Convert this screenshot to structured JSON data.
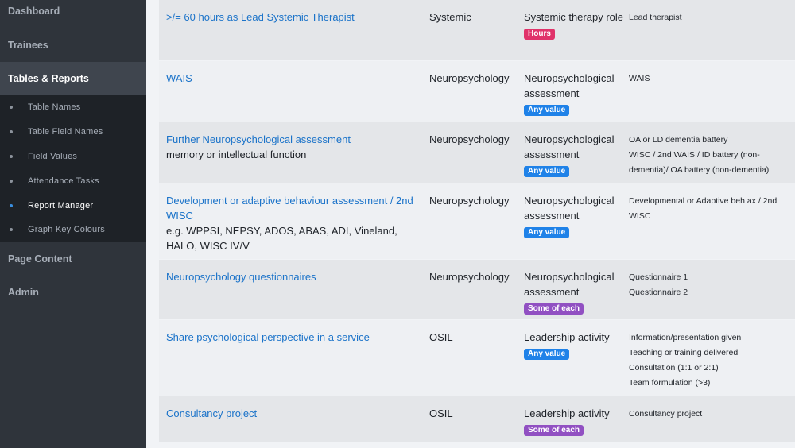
{
  "sidebar": {
    "top_items": [
      {
        "label": "Dashboard"
      },
      {
        "label": "Trainees"
      },
      {
        "label": "Tables & Reports"
      }
    ],
    "sub_items": [
      {
        "label": "Table Names"
      },
      {
        "label": "Table Field Names"
      },
      {
        "label": "Field Values"
      },
      {
        "label": "Attendance Tasks"
      },
      {
        "label": "Report Manager"
      },
      {
        "label": "Graph Key Colours"
      }
    ],
    "bottom_items": [
      {
        "label": "Page Content"
      },
      {
        "label": "Admin"
      }
    ],
    "active_top": "Tables & Reports",
    "active_sub": "Report Manager"
  },
  "rows": [
    {
      "name": ">/= 60 hours as Lead Systemic Therapist",
      "note": "",
      "category": "Systemic",
      "type": "Systemic therapy role",
      "badge": "Hours",
      "fields": [
        "Lead therapist"
      ]
    },
    {
      "name": "WAIS",
      "note": "",
      "category": "Neuropsychology",
      "type": "Neuropsychological assessment",
      "badge": "Any value",
      "fields": [
        "WAIS"
      ]
    },
    {
      "name": "Further Neuropsychological assessment",
      "note": "memory or intellectual function",
      "category": "Neuropsychology",
      "type": "Neuropsychological assessment",
      "badge": "Any value",
      "fields": [
        "OA or LD dementia battery",
        "WISC / 2nd WAIS / ID battery (non-dementia)/ OA battery (non-dementia)"
      ]
    },
    {
      "name": "Development or adaptive behaviour assessment / 2nd WISC",
      "note": "e.g. WPPSI, NEPSY, ADOS, ABAS, ADI, Vineland, HALO, WISC IV/V",
      "category": "Neuropsychology",
      "type": "Neuropsychological assessment",
      "badge": "Any value",
      "fields": [
        "Developmental or Adaptive beh ax / 2nd WISC"
      ]
    },
    {
      "name": "Neuropsychology questionnaires",
      "note": "",
      "category": "Neuropsychology",
      "type": "Neuropsychological assessment",
      "badge": "Some of each",
      "fields": [
        "Questionnaire 1",
        "Questionnaire 2"
      ]
    },
    {
      "name": "Share psychological perspective in a service",
      "note": "",
      "category": "OSIL",
      "type": "Leadership activity",
      "badge": "Any value",
      "fields": [
        "Information/presentation given",
        "Teaching or training delivered",
        "Consultation (1:1 or 2:1)",
        "Team formulation (>3)"
      ]
    },
    {
      "name": "Consultancy project",
      "note": "",
      "category": "OSIL",
      "type": "Leadership activity",
      "badge": "Some of each",
      "fields": [
        "Consultancy project"
      ]
    }
  ]
}
